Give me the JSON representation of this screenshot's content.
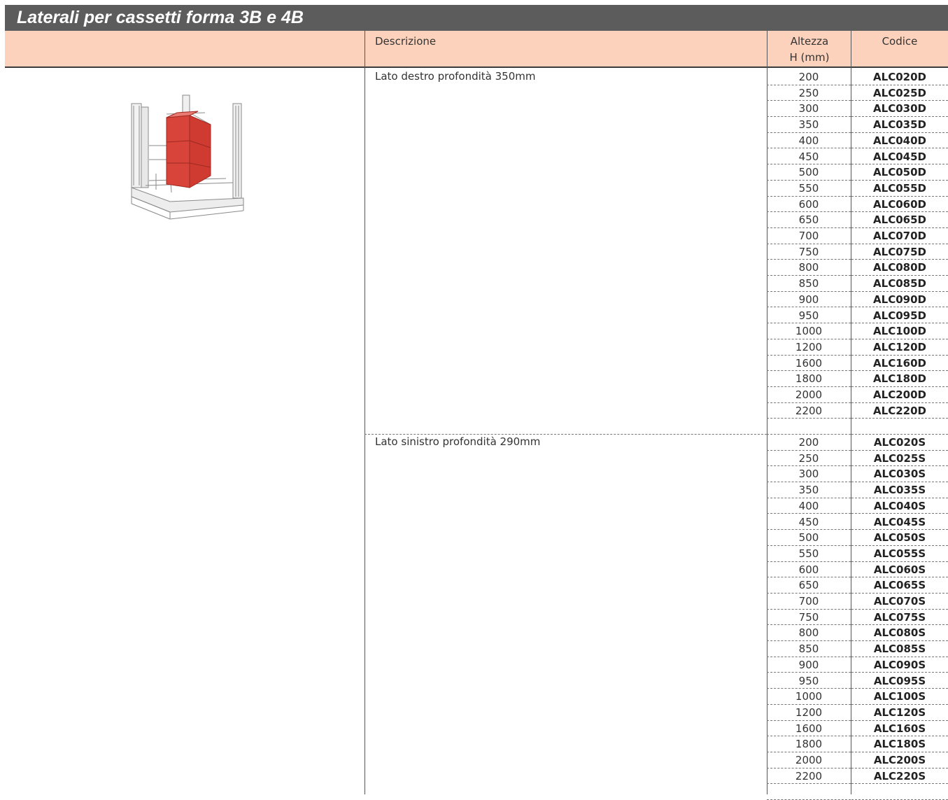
{
  "title": "Laterali per cassetti forma 3B e 4B",
  "headers": {
    "descrizione": "Descrizione",
    "altezza_line1": "Altezza",
    "altezza_line2": "H (mm)",
    "codice": "Codice"
  },
  "colors": {
    "title_bar": "#5c5c5c",
    "header_bg": "#fdd2bc",
    "panel_red": "#d9443a"
  },
  "groups": [
    {
      "descrizione": "Lato destro profondità 350mm",
      "rows": [
        {
          "altezza": "200",
          "codice": "ALC020D"
        },
        {
          "altezza": "250",
          "codice": "ALC025D"
        },
        {
          "altezza": "300",
          "codice": "ALC030D"
        },
        {
          "altezza": "350",
          "codice": "ALC035D"
        },
        {
          "altezza": "400",
          "codice": "ALC040D"
        },
        {
          "altezza": "450",
          "codice": "ALC045D"
        },
        {
          "altezza": "500",
          "codice": "ALC050D"
        },
        {
          "altezza": "550",
          "codice": "ALC055D"
        },
        {
          "altezza": "600",
          "codice": "ALC060D"
        },
        {
          "altezza": "650",
          "codice": "ALC065D"
        },
        {
          "altezza": "700",
          "codice": "ALC070D"
        },
        {
          "altezza": "750",
          "codice": "ALC075D"
        },
        {
          "altezza": "800",
          "codice": "ALC080D"
        },
        {
          "altezza": "850",
          "codice": "ALC085D"
        },
        {
          "altezza": "900",
          "codice": "ALC090D"
        },
        {
          "altezza": "950",
          "codice": "ALC095D"
        },
        {
          "altezza": "1000",
          "codice": "ALC100D"
        },
        {
          "altezza": "1200",
          "codice": "ALC120D"
        },
        {
          "altezza": "1600",
          "codice": "ALC160D"
        },
        {
          "altezza": "1800",
          "codice": "ALC180D"
        },
        {
          "altezza": "2000",
          "codice": "ALC200D"
        },
        {
          "altezza": "2200",
          "codice": "ALC220D"
        }
      ]
    },
    {
      "descrizione": "Lato sinistro profondità 290mm",
      "rows": [
        {
          "altezza": "200",
          "codice": "ALC020S"
        },
        {
          "altezza": "250",
          "codice": "ALC025S"
        },
        {
          "altezza": "300",
          "codice": "ALC030S"
        },
        {
          "altezza": "350",
          "codice": "ALC035S"
        },
        {
          "altezza": "400",
          "codice": "ALC040S"
        },
        {
          "altezza": "450",
          "codice": "ALC045S"
        },
        {
          "altezza": "500",
          "codice": "ALC050S"
        },
        {
          "altezza": "550",
          "codice": "ALC055S"
        },
        {
          "altezza": "600",
          "codice": "ALC060S"
        },
        {
          "altezza": "650",
          "codice": "ALC065S"
        },
        {
          "altezza": "700",
          "codice": "ALC070S"
        },
        {
          "altezza": "750",
          "codice": "ALC075S"
        },
        {
          "altezza": "800",
          "codice": "ALC080S"
        },
        {
          "altezza": "850",
          "codice": "ALC085S"
        },
        {
          "altezza": "900",
          "codice": "ALC090S"
        },
        {
          "altezza": "950",
          "codice": "ALC095S"
        },
        {
          "altezza": "1000",
          "codice": "ALC100S"
        },
        {
          "altezza": "1200",
          "codice": "ALC120S"
        },
        {
          "altezza": "1600",
          "codice": "ALC160S"
        },
        {
          "altezza": "1800",
          "codice": "ALC180S"
        },
        {
          "altezza": "2000",
          "codice": "ALC200S"
        },
        {
          "altezza": "2200",
          "codice": "ALC220S"
        }
      ]
    }
  ]
}
